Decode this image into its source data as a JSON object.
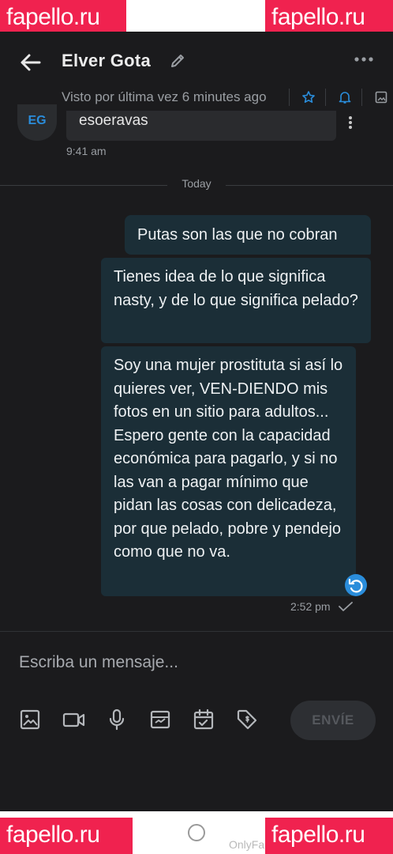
{
  "watermark": "fapello.ru",
  "header": {
    "contact_name": "Elver Gota",
    "last_seen": "Visto por última vez 6 minutes ago"
  },
  "thread": {
    "avatar_initials": "EG",
    "incoming_message": "esoeravas",
    "incoming_time": "9:41 am",
    "day_divider": "Today",
    "outgoing": [
      "Putas son las que no cobran",
      "Tienes idea de lo que significa nasty, y de lo que significa pelado?",
      "Soy una mujer prostituta si así lo quieres ver, VEN-DIENDO mis fotos en un sitio para adultos... Espero gente con la capacidad económica para pagarlo, y si no las van a pagar mínimo que pidan las cosas con delicadeza, por que pelado, pobre y pendejo como que no va."
    ],
    "outgoing_time": "2:52 pm"
  },
  "composer": {
    "placeholder": "Escriba un mensaje...",
    "send_label": "ENVÍE"
  },
  "navbar": {
    "partial_label": "OnlyFa"
  },
  "colors": {
    "background": "#1b1b1d",
    "outgoing_bubble": "#1b2e37",
    "incoming_bubble": "#2a2b2e",
    "accent": "#2a8ddb",
    "watermark": "#f0224f"
  }
}
